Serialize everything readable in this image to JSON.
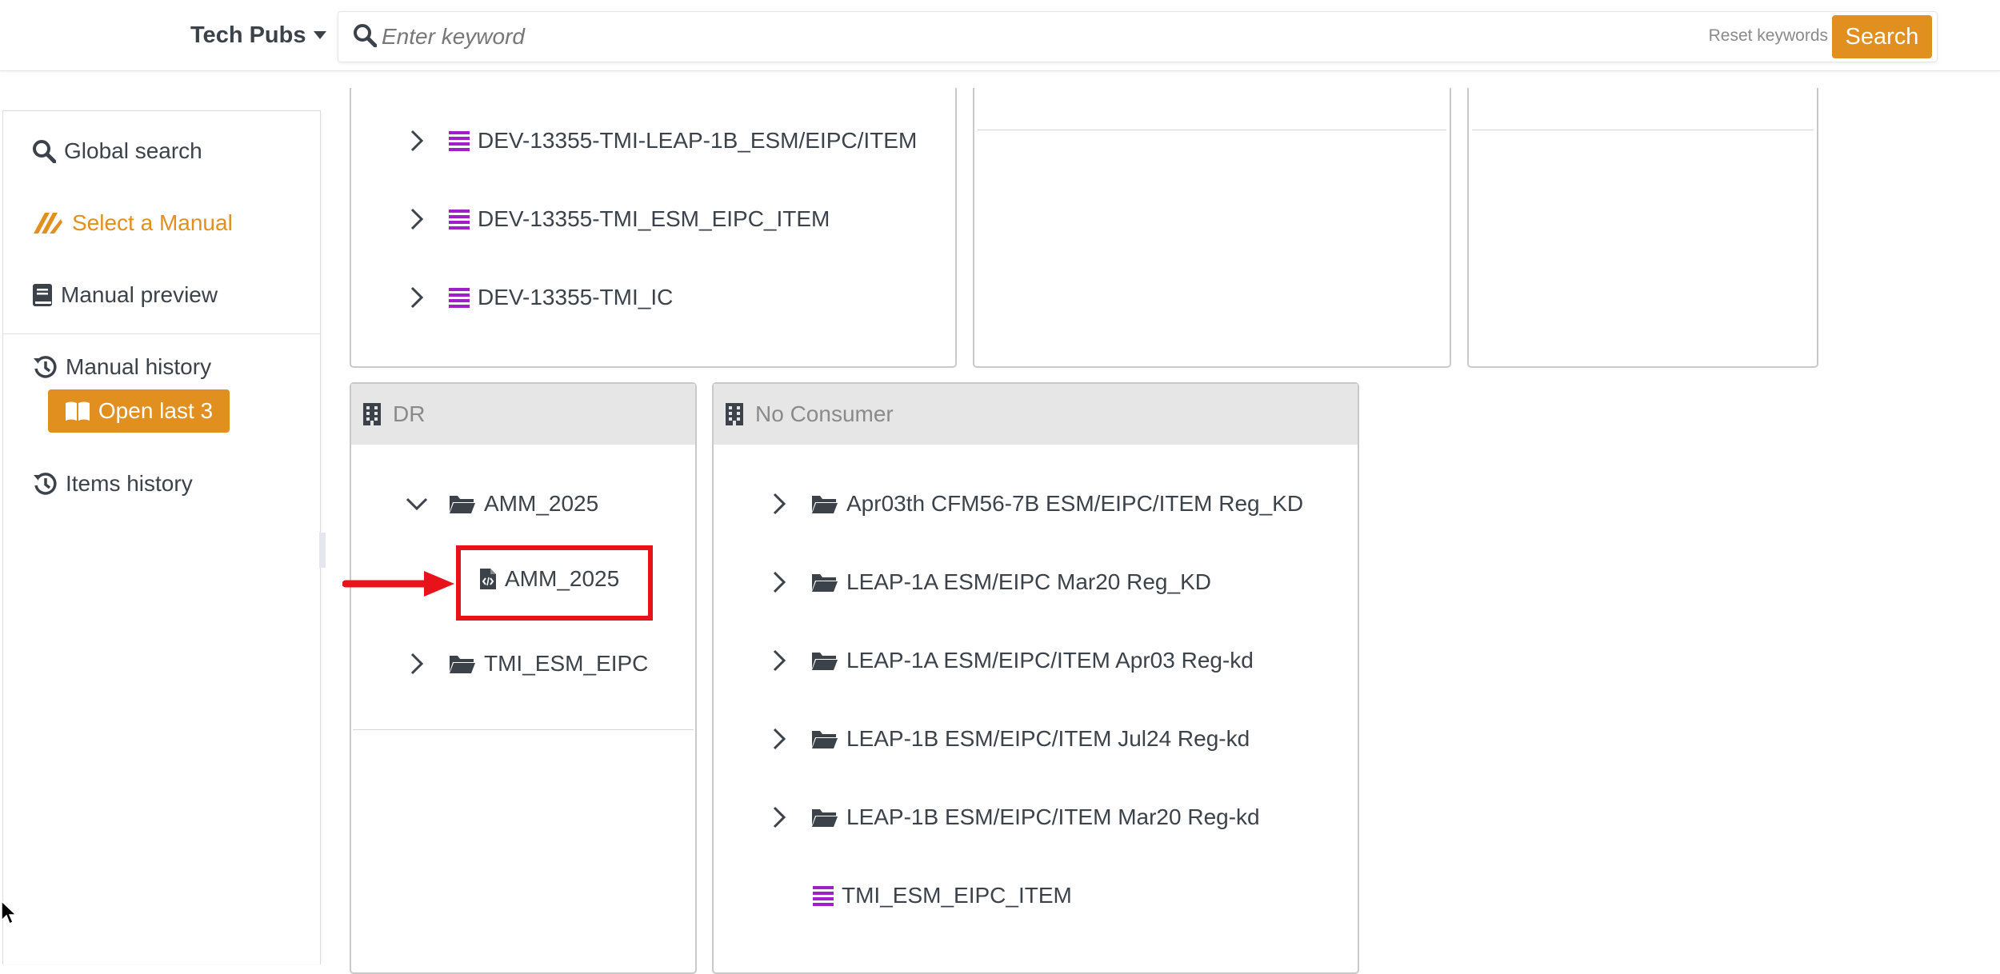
{
  "header": {
    "app_name": "Tech Pubs",
    "search_placeholder": "Enter keyword",
    "search_value": "",
    "reset_label": "Reset keywords",
    "search_button_label": "Search"
  },
  "sidebar": {
    "items": [
      {
        "label": "Global search",
        "icon": "search-icon",
        "active": false
      },
      {
        "label": "Select a Manual",
        "icon": "manual-select-icon",
        "active": true
      },
      {
        "label": "Manual preview",
        "icon": "book-icon",
        "active": false
      },
      {
        "label": "Manual history",
        "icon": "history-icon",
        "active": false
      },
      {
        "label": "Items history",
        "icon": "history-icon",
        "active": false
      }
    ],
    "open_last_label": "Open last 3"
  },
  "panels": {
    "top_left": {
      "items": [
        {
          "label": "DEV-13355-TMI-LEAP-1B_ESM/EIPC/ITEM",
          "type": "list"
        },
        {
          "label": "DEV-13355-TMI_ESM_EIPC_ITEM",
          "type": "list"
        },
        {
          "label": "DEV-13355-TMI_IC",
          "type": "list"
        }
      ]
    },
    "dr": {
      "title": "DR",
      "items": [
        {
          "label": "AMM_2025",
          "type": "folder",
          "expanded": true
        },
        {
          "label": "AMM_2025",
          "type": "file-code",
          "highlighted": true
        },
        {
          "label": "TMI_ESM_EIPC",
          "type": "folder",
          "expanded": false
        }
      ]
    },
    "no_consumer": {
      "title": "No Consumer",
      "items": [
        {
          "label": "Apr03th CFM56-7B ESM/EIPC/ITEM Reg_KD",
          "type": "folder"
        },
        {
          "label": "LEAP-1A ESM/EIPC Mar20 Reg_KD",
          "type": "folder"
        },
        {
          "label": "LEAP-1A ESM/EIPC/ITEM Apr03 Reg-kd",
          "type": "folder"
        },
        {
          "label": "LEAP-1B ESM/EIPC/ITEM Jul24 Reg-kd",
          "type": "folder"
        },
        {
          "label": "LEAP-1B ESM/EIPC/ITEM Mar20 Reg-kd",
          "type": "folder"
        },
        {
          "label": "TMI_ESM_EIPC_ITEM",
          "type": "list"
        }
      ]
    }
  },
  "colors": {
    "accent": "#e1901f",
    "list_icon": "#a020c8",
    "highlight": "#e8121a"
  }
}
